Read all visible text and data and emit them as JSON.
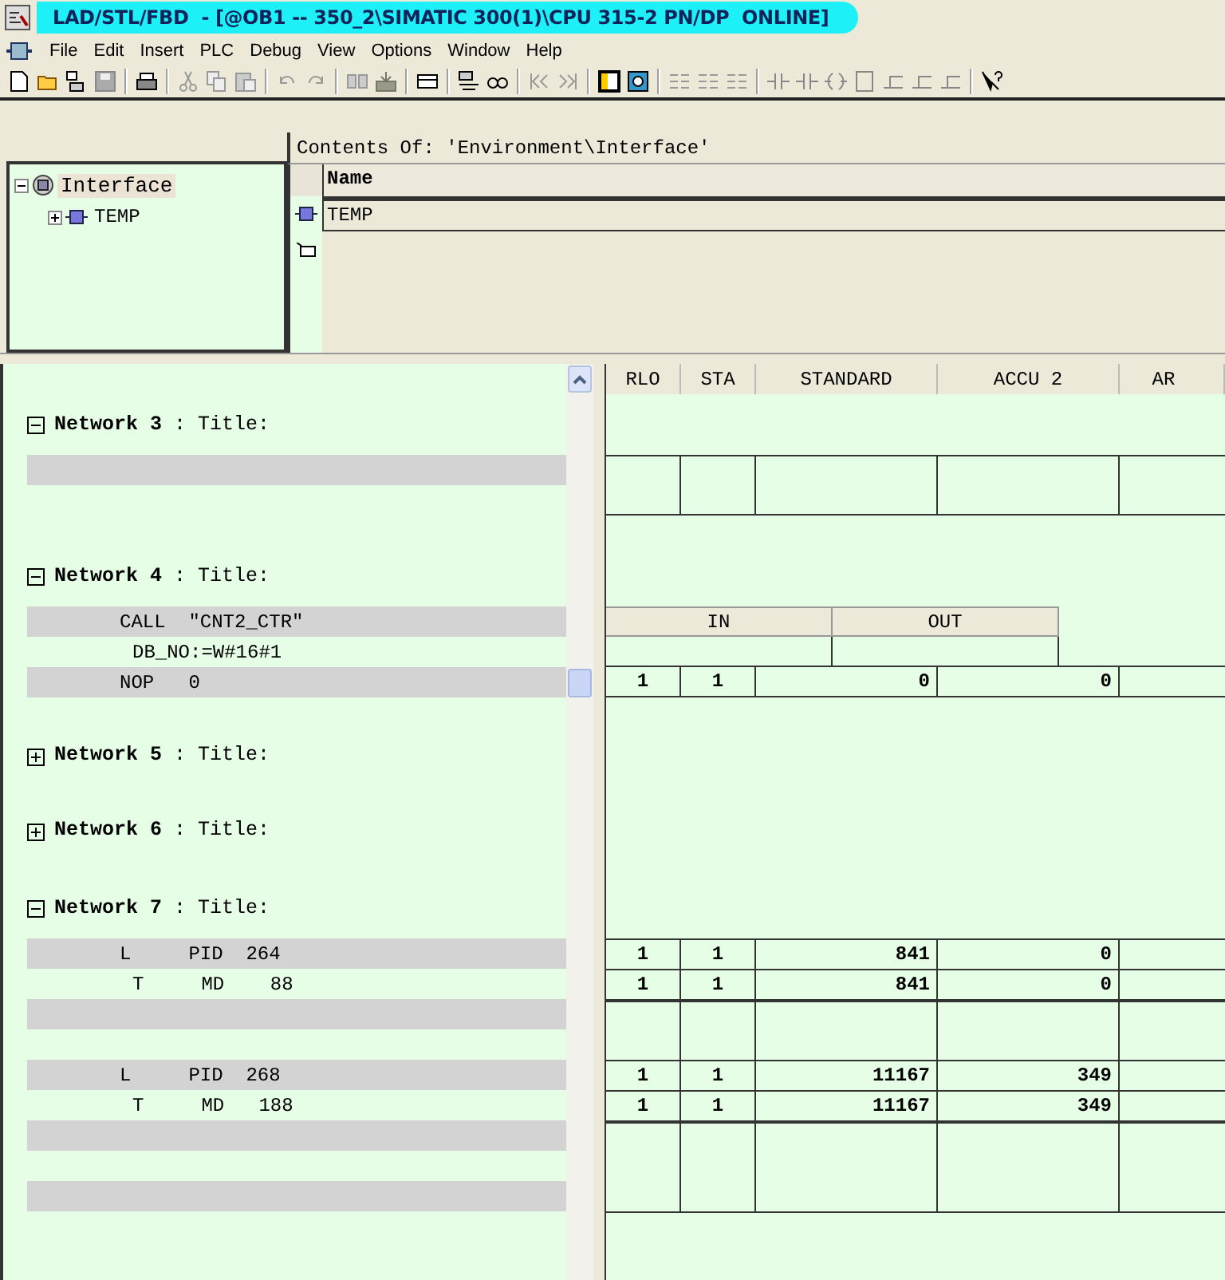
{
  "window": {
    "title": "LAD/STL/FBD  - [@OB1 -- 350_2\\SIMATIC 300(1)\\CPU 315-2 PN/DP  ONLINE]"
  },
  "menu": [
    "File",
    "Edit",
    "Insert",
    "PLC",
    "Debug",
    "View",
    "Options",
    "Window",
    "Help"
  ],
  "interface": {
    "heading": "Contents Of: 'Environment\\Interface'",
    "tree": [
      {
        "label": "Interface",
        "expanded": true,
        "selected": true,
        "children": [
          {
            "label": "TEMP",
            "expanded": false,
            "selected": false
          }
        ]
      }
    ],
    "columns": [
      "Name"
    ],
    "rows": [
      {
        "name": "TEMP"
      }
    ]
  },
  "networks": [
    {
      "heading": "**Network 3** : Title:",
      "expanded": true,
      "lines": [
        {
          "kind": "statement"
        },
        {
          "kind": "blank"
        },
        {
          "kind": "blank"
        }
      ]
    },
    {
      "heading": "**Network 4** : Title:",
      "expanded": true,
      "lines": [
        {
          "kind": "statement",
          "text": "CALL  \"CNT2_CTR\""
        },
        {
          "kind": "param",
          "text": "DB_NO:=W#16#1"
        },
        {
          "kind": "statement",
          "text": "NOP   0"
        },
        {
          "kind": "blank"
        }
      ]
    },
    {
      "heading": "**Network 5** : Title:",
      "expanded": false
    },
    {
      "heading": "**Network 6** : Title:",
      "expanded": false
    },
    {
      "heading": "**Network 7** : Title:",
      "expanded": true,
      "lines": [
        {
          "kind": "statement",
          "text": "L     PID  264"
        },
        {
          "kind": "param",
          "text": "T     MD    88"
        },
        {
          "kind": "statement"
        },
        {
          "kind": "blank"
        },
        {
          "kind": "statement",
          "text": "L     PID  268"
        },
        {
          "kind": "param",
          "text": "T     MD   188"
        },
        {
          "kind": "statement"
        },
        {
          "kind": "blank"
        },
        {
          "kind": "statement"
        }
      ]
    }
  ],
  "status": {
    "columns": [
      "RLO",
      "STA",
      "STANDARD",
      "ACCU 2",
      "AR"
    ],
    "rows": [
      {
        "kind": "blank"
      },
      {
        "kind": "blank"
      },
      {
        "kind": "empty"
      },
      {
        "kind": "empty"
      },
      {
        "kind": "blank"
      },
      {
        "kind": "blank"
      },
      {
        "kind": "blank"
      },
      {
        "kind": "params-header",
        "cells": [
          "IN",
          "OUT"
        ]
      },
      {
        "kind": "params"
      },
      {
        "kind": "values",
        "cells": [
          "1",
          "1",
          "0",
          "0"
        ]
      },
      {
        "kind": "blank"
      },
      {
        "kind": "blank"
      },
      {
        "kind": "blank"
      },
      {
        "kind": "blank"
      },
      {
        "kind": "blank"
      },
      {
        "kind": "blank"
      },
      {
        "kind": "blank"
      },
      {
        "kind": "blank"
      },
      {
        "kind": "values",
        "cells": [
          "1",
          "1",
          "841",
          "0"
        ]
      },
      {
        "kind": "values",
        "cells": [
          "1",
          "1",
          "841",
          "0"
        ]
      },
      {
        "kind": "empty"
      },
      {
        "kind": "empty"
      },
      {
        "kind": "values",
        "cells": [
          "1",
          "1",
          "11167",
          "349"
        ]
      },
      {
        "kind": "values",
        "cells": [
          "1",
          "1",
          "11167",
          "349"
        ]
      },
      {
        "kind": "empty"
      },
      {
        "kind": "empty"
      },
      {
        "kind": "empty"
      }
    ]
  }
}
